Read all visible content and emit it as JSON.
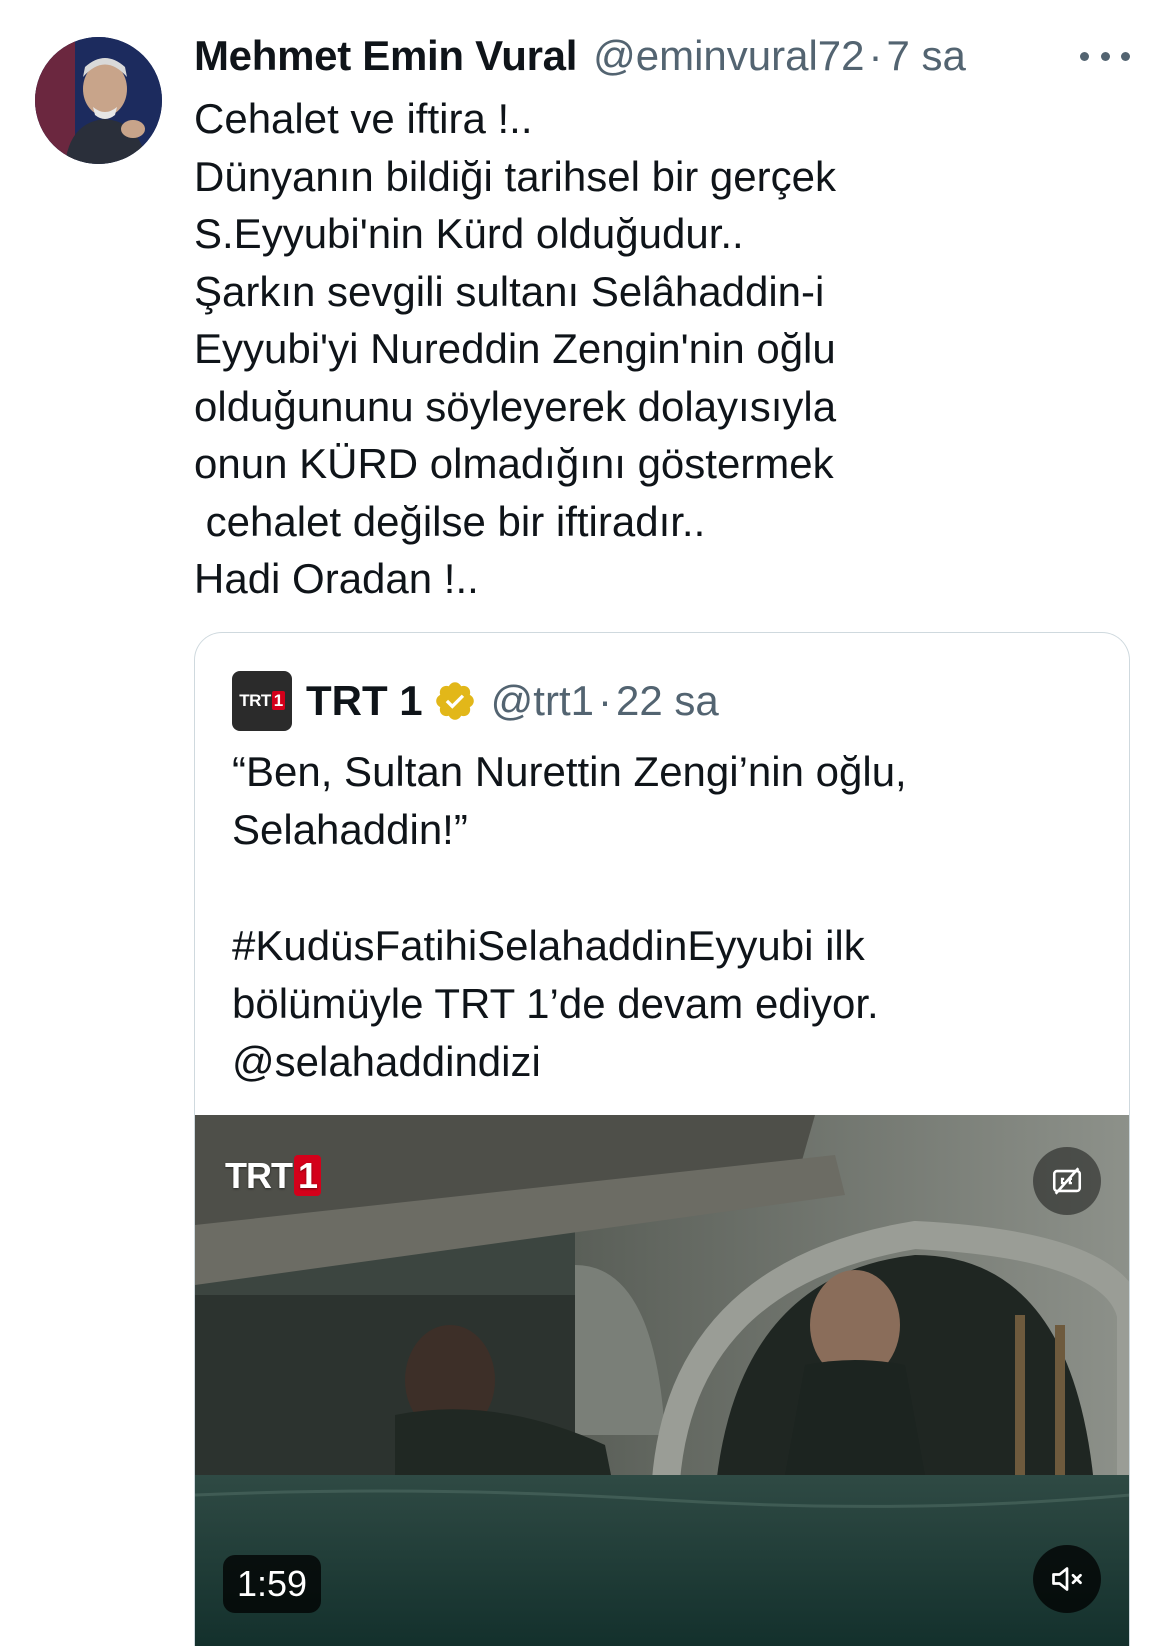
{
  "tweet": {
    "author_name": "Mehmet Emin Vural",
    "handle": "@eminvural72",
    "separator": "·",
    "time": "7 sa",
    "avatar_icon": "user-avatar",
    "more_icon": "more-options-icon",
    "text_lines": [
      "Cehalet ve iftira !..",
      "Dünyanın bildiği tarihsel bir gerçek",
      "S.Eyyubi'nin Kürd olduğudur..",
      "Şarkın sevgili sultanı Selâhaddin-i",
      "Eyyubi'yi Nureddin Zengin'nin oğlu",
      "olduğununu söyleyerek dolayısıyla",
      "onun KÜRD olmadığını göstermek",
      " cehalet değilse bir iftiradır..",
      "Hadi Oradan !.."
    ]
  },
  "quoted_tweet": {
    "avatar_text": "TRT",
    "avatar_text_accent": "1",
    "author_name": "TRT 1",
    "verified_icon": "verified-badge-icon",
    "verified_color": "#e2b719",
    "handle": "@trt1",
    "separator": "·",
    "time": "22 sa",
    "text_lines": [
      "“Ben, Sultan Nurettin Zengi’nin oğlu,",
      "Selahaddin!”",
      "",
      "#KudüsFatihiSelahaddinEyyubi ilk",
      "bölümüyle TRT 1’de devam ediyor.",
      "@selahaddindizi"
    ],
    "media": {
      "type": "video",
      "logo_text": "TRT",
      "logo_accent": "1",
      "duration": "1:59",
      "cc_icon": "captions-off-icon",
      "mute_icon": "muted-speaker-icon"
    }
  },
  "colors": {
    "text_primary": "#0f1419",
    "text_secondary": "#536471",
    "border": "#cfd9de",
    "trt_red": "#d4001a"
  }
}
